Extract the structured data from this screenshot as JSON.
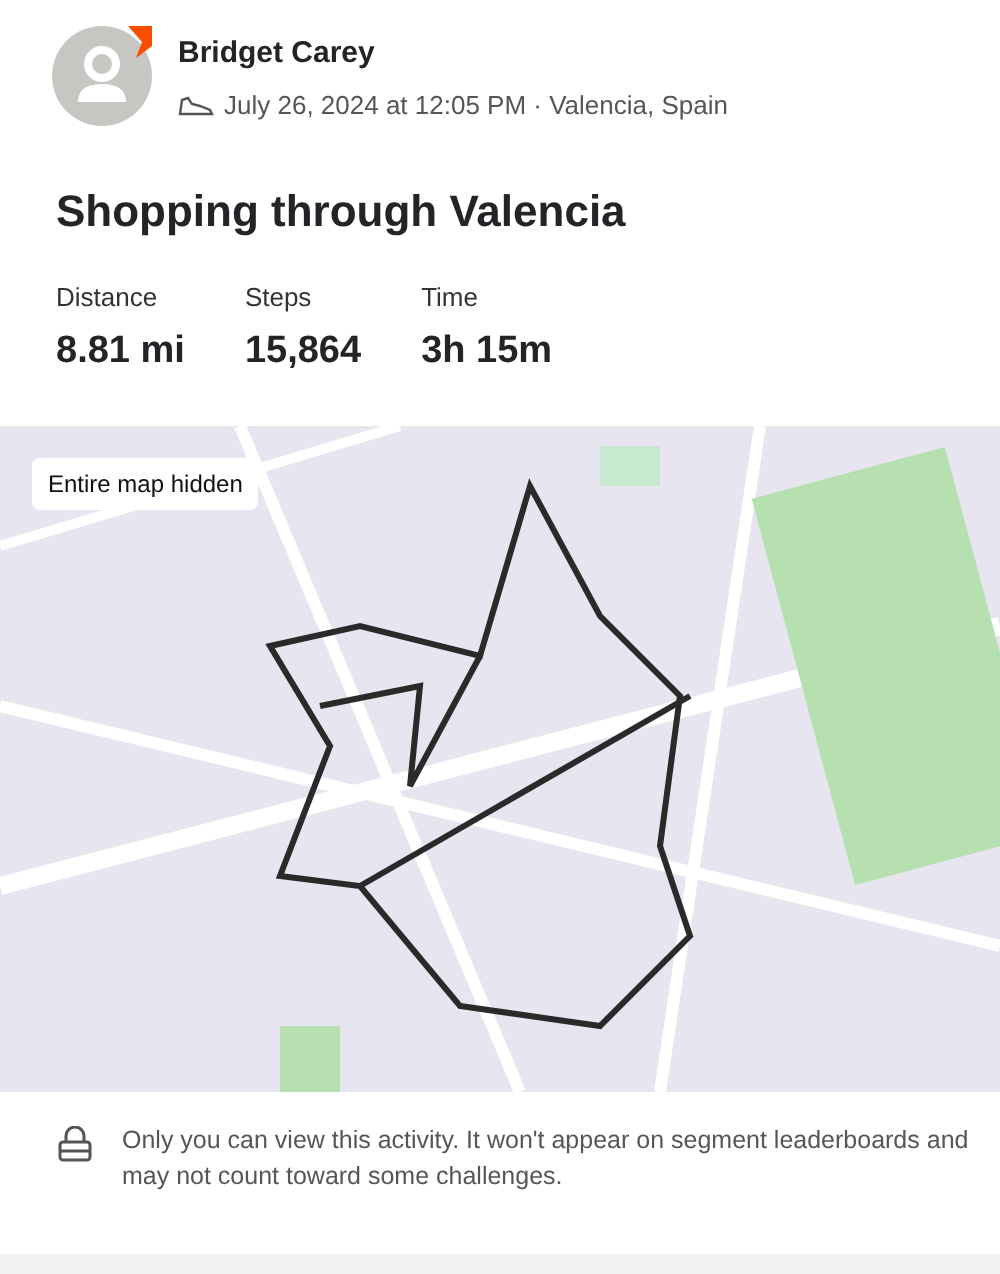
{
  "athlete": {
    "name": "Bridget Carey",
    "meta": "July 26, 2024 at 12:05 PM · Valencia, Spain"
  },
  "title": "Shopping through Valencia",
  "stats": [
    {
      "label": "Distance",
      "value": "8.81 mi"
    },
    {
      "label": "Steps",
      "value": "15,864"
    },
    {
      "label": "Time",
      "value": "3h 15m"
    }
  ],
  "map": {
    "badge": "Entire map hidden"
  },
  "privacy_note": "Only you can view this activity. It won't appear on segment leaderboards and may not count toward some challenges."
}
